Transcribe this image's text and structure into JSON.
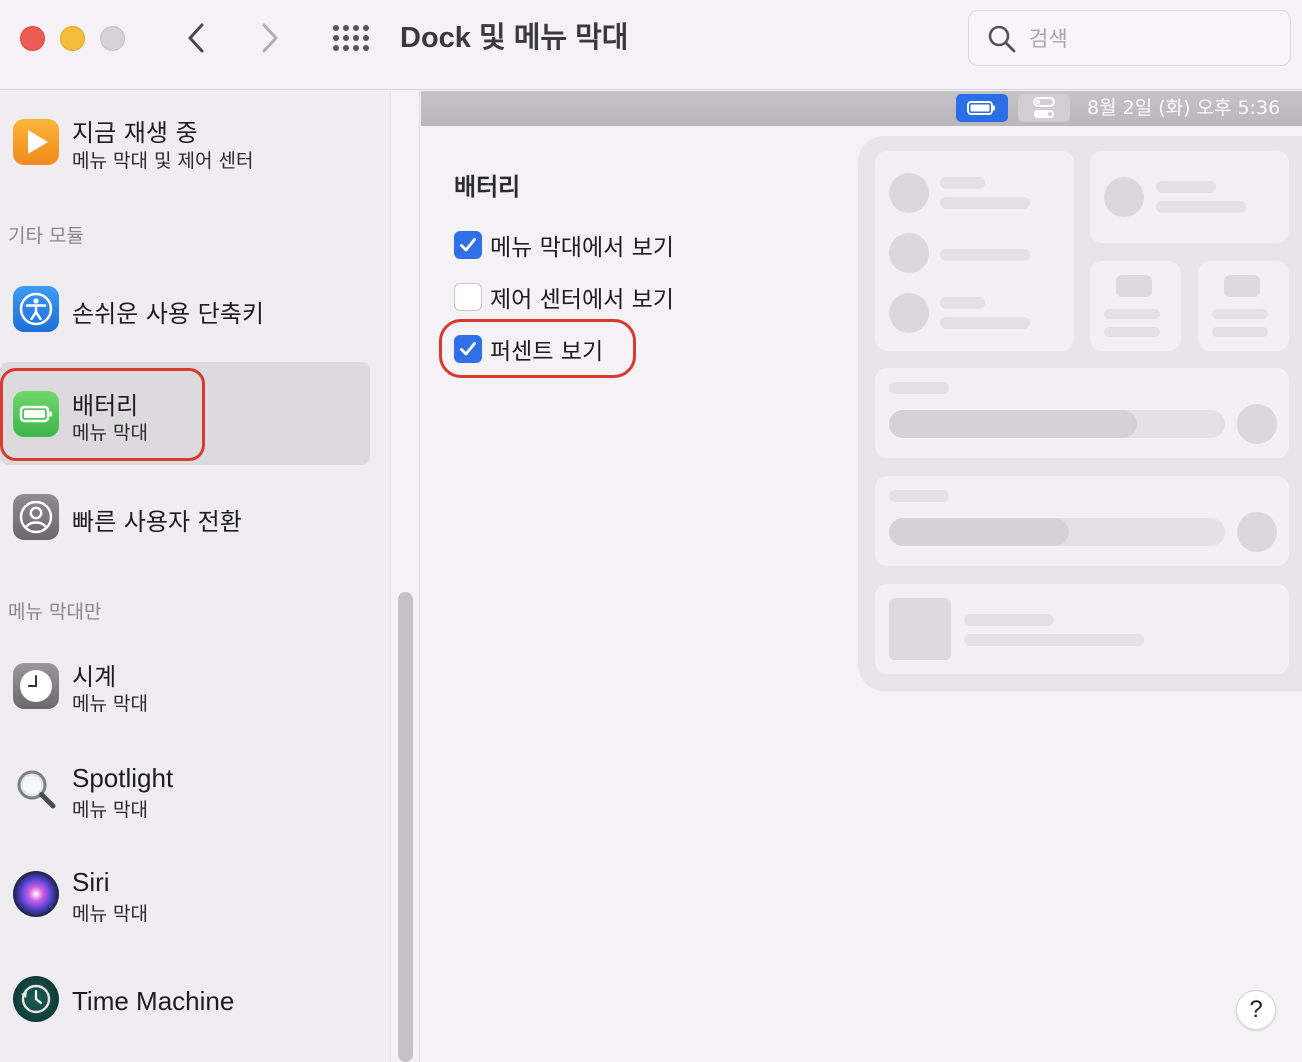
{
  "window": {
    "title": "Dock 및 메뉴 막대",
    "search_placeholder": "검색"
  },
  "sidebar": {
    "items": [
      {
        "title": "지금 재생 중",
        "subtitle": "메뉴 막대 및 제어 센터",
        "icon": "play-icon"
      },
      {
        "title": "손쉬운 사용 단축키",
        "subtitle": "",
        "icon": "accessibility-icon"
      },
      {
        "title": "배터리",
        "subtitle": "메뉴 막대",
        "icon": "battery-icon",
        "selected": true
      },
      {
        "title": "빠른 사용자 전환",
        "subtitle": "",
        "icon": "user-switch-icon"
      },
      {
        "title": "시계",
        "subtitle": "메뉴 막대",
        "icon": "clock-icon"
      },
      {
        "title": "Spotlight",
        "subtitle": "메뉴 막대",
        "icon": "spotlight-icon"
      },
      {
        "title": "Siri",
        "subtitle": "메뉴 막대",
        "icon": "siri-icon"
      },
      {
        "title": "Time Machine",
        "subtitle": "",
        "icon": "time-machine-icon"
      }
    ],
    "sections": {
      "other_modules": "기타 모듈",
      "menubar_only": "메뉴 막대만"
    }
  },
  "menubar_preview": {
    "clock": "8월 2일 (화) 오후  5:36"
  },
  "main": {
    "section_title": "배터리",
    "options": [
      {
        "label": "메뉴 막대에서 보기",
        "checked": true
      },
      {
        "label": "제어 센터에서 보기",
        "checked": false
      },
      {
        "label": "퍼센트 보기",
        "checked": true
      }
    ],
    "help_label": "?"
  },
  "colors": {
    "accent": "#2f6fe8",
    "highlight": "#d9392e",
    "battery_icon": "#4cc35b"
  }
}
